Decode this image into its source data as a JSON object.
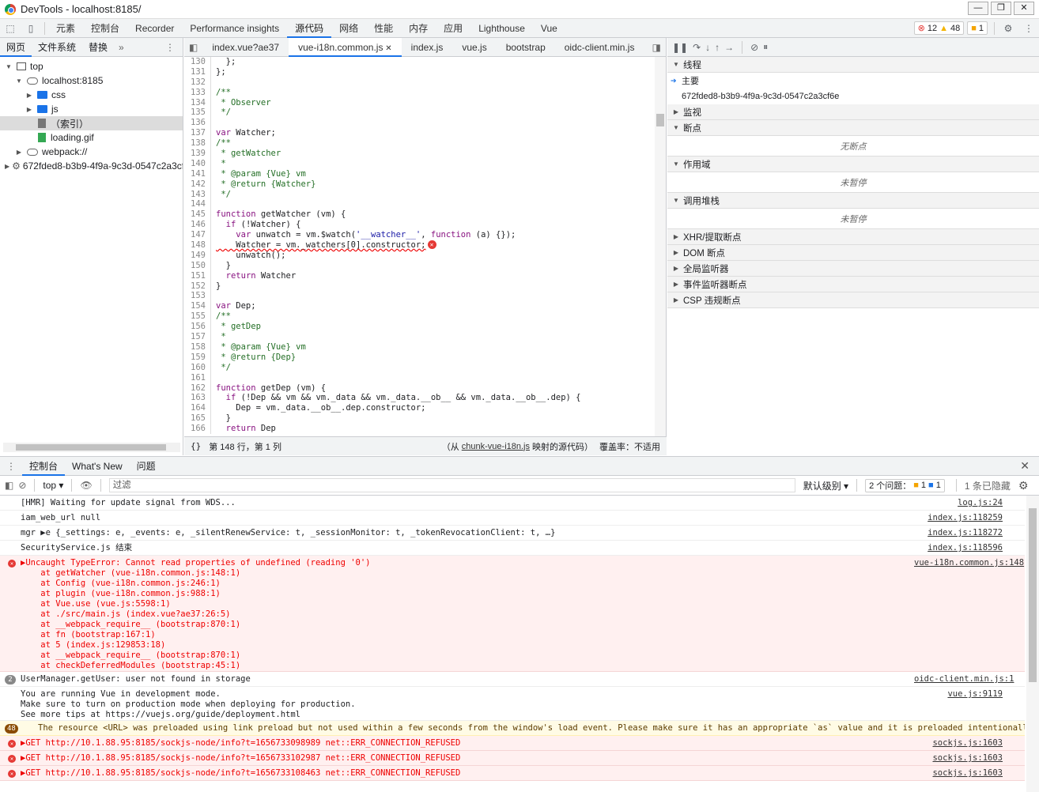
{
  "window": {
    "title": "DevTools - localhost:8185/"
  },
  "tabs": [
    "元素",
    "控制台",
    "Recorder",
    "Performance insights",
    "源代码",
    "网络",
    "性能",
    "内存",
    "应用",
    "Lighthouse",
    "Vue"
  ],
  "counts": {
    "errors": "12",
    "warnings": "48",
    "issues": "1"
  },
  "nav": {
    "tabs": [
      "网页",
      "文件系统",
      "替换"
    ],
    "tree": [
      {
        "label": "top",
        "indent": 0,
        "tri": "▼",
        "icon": "frame"
      },
      {
        "label": "localhost:8185",
        "indent": 1,
        "tri": "▼",
        "icon": "cloud"
      },
      {
        "label": "css",
        "indent": 2,
        "tri": "▶",
        "icon": "folder"
      },
      {
        "label": "js",
        "indent": 2,
        "tri": "▶",
        "icon": "folder"
      },
      {
        "label": "（索引）",
        "indent": 2,
        "tri": "",
        "icon": "file",
        "selected": true
      },
      {
        "label": "loading.gif",
        "indent": 2,
        "tri": "",
        "icon": "filegreen"
      },
      {
        "label": "webpack://",
        "indent": 1,
        "tri": "▶",
        "icon": "cloud"
      },
      {
        "label": "672fded8-b3b9-4f9a-9c3d-0547c2a3cf6e",
        "indent": 0,
        "tri": "▶",
        "icon": "gear"
      }
    ]
  },
  "editor": {
    "files": [
      "index.vue?ae37",
      "vue-i18n.common.js",
      "index.js",
      "vue.js",
      "bootstrap",
      "oidc-client.min.js"
    ],
    "lines": [
      {
        "n": "130",
        "t": "  };"
      },
      {
        "n": "131",
        "t": "};"
      },
      {
        "n": "132",
        "t": ""
      },
      {
        "n": "133",
        "t": "/**",
        "c": "cm"
      },
      {
        "n": "134",
        "t": " * Observer",
        "c": "cm"
      },
      {
        "n": "135",
        "t": " */",
        "c": "cm"
      },
      {
        "n": "136",
        "t": ""
      },
      {
        "n": "137",
        "t": "var Watcher;"
      },
      {
        "n": "138",
        "t": "/**",
        "c": "cm"
      },
      {
        "n": "139",
        "t": " * getWatcher",
        "c": "cm"
      },
      {
        "n": "140",
        "t": " *",
        "c": "cm"
      },
      {
        "n": "141",
        "t": " * @param {Vue} vm",
        "c": "cm"
      },
      {
        "n": "142",
        "t": " * @return {Watcher}",
        "c": "cm"
      },
      {
        "n": "143",
        "t": " */",
        "c": "cm"
      },
      {
        "n": "144",
        "t": ""
      },
      {
        "n": "145",
        "t": "function getWatcher (vm) {"
      },
      {
        "n": "146",
        "t": "  if (!Watcher) {"
      },
      {
        "n": "147",
        "t": "    var unwatch = vm.$watch('__watcher__', function (a) {});"
      },
      {
        "n": "148",
        "t": "    Watcher = vm._watchers[0].constructor;",
        "err": true
      },
      {
        "n": "149",
        "t": "    unwatch();"
      },
      {
        "n": "150",
        "t": "  }"
      },
      {
        "n": "151",
        "t": "  return Watcher"
      },
      {
        "n": "152",
        "t": "}"
      },
      {
        "n": "153",
        "t": ""
      },
      {
        "n": "154",
        "t": "var Dep;"
      },
      {
        "n": "155",
        "t": "/**",
        "c": "cm"
      },
      {
        "n": "156",
        "t": " * getDep",
        "c": "cm"
      },
      {
        "n": "157",
        "t": " *",
        "c": "cm"
      },
      {
        "n": "158",
        "t": " * @param {Vue} vm",
        "c": "cm"
      },
      {
        "n": "159",
        "t": " * @return {Dep}",
        "c": "cm"
      },
      {
        "n": "160",
        "t": " */",
        "c": "cm"
      },
      {
        "n": "161",
        "t": ""
      },
      {
        "n": "162",
        "t": "function getDep (vm) {"
      },
      {
        "n": "163",
        "t": "  if (!Dep && vm && vm._data && vm._data.__ob__ && vm._data.__ob__.dep) {"
      },
      {
        "n": "164",
        "t": "    Dep = vm._data.__ob__.dep.constructor;"
      },
      {
        "n": "165",
        "t": "  }"
      },
      {
        "n": "166",
        "t": "  return Dep"
      }
    ],
    "status": {
      "braces": "{}",
      "position": "第 148 行，第 1 列",
      "mapped_prefix": "（从",
      "mapped_file": "chunk-vue-i18n.js",
      "mapped_suffix": "映射的源代码）",
      "coverage": "覆盖率：不适用"
    }
  },
  "debugger": {
    "threads_title": "线程",
    "main_thread": "主要",
    "worker": "672fded8-b3b9-4f9a-9c3d-0547c2a3cf6e",
    "watch": "监视",
    "breakpoints": "断点",
    "no_breakpoints": "无断点",
    "scope": "作用域",
    "not_paused": "未暂停",
    "callstack": "调用堆栈",
    "not_paused2": "未暂停",
    "sections": [
      "XHR/提取断点",
      "DOM 断点",
      "全局监听器",
      "事件监听器断点",
      "CSP 违规断点"
    ]
  },
  "drawer": {
    "tabs": [
      "控制台",
      "What's New",
      "问题"
    ]
  },
  "console": {
    "context": "top",
    "filter_placeholder": "过滤",
    "levels": "默认级别",
    "issues_label": "2 个问题：",
    "issues_a": "1",
    "issues_b": "1",
    "hidden": "1 条已隐藏",
    "messages": [
      {
        "type": "log",
        "text": "[HMR] Waiting for update signal from WDS...",
        "src": "log.js:24"
      },
      {
        "type": "log",
        "text": "iam_web_url null",
        "src": "index.js:118259"
      },
      {
        "type": "log",
        "text": "mgr ▶e {_settings: e, _events: e, _silentRenewService: t, _sessionMonitor: t, _tokenRevocationClient: t, …}",
        "src": "index.js:118272"
      },
      {
        "type": "log",
        "text": "SecurityService.js 结束",
        "src": "index.js:118596"
      },
      {
        "type": "err",
        "text": "▶Uncaught TypeError: Cannot read properties of undefined (reading '0')\n    at getWatcher (vue-i18n.common.js:148:1)\n    at Config (vue-i18n.common.js:246:1)\n    at plugin (vue-i18n.common.js:988:1)\n    at Vue.use (vue.js:5598:1)\n    at ./src/main.js (index.vue?ae37:26:5)\n    at __webpack_require__ (bootstrap:870:1)\n    at fn (bootstrap:167:1)\n    at 5 (index.js:129853:18)\n    at __webpack_require__ (bootstrap:870:1)\n    at checkDeferredModules (bootstrap:45:1)",
        "src": "vue-i18n.common.js:148"
      },
      {
        "type": "log",
        "text": "UserManager.getUser: user not found in storage",
        "src": "oidc-client.min.js:1",
        "count": "2"
      },
      {
        "type": "log",
        "text": "You are running Vue in development mode.\nMake sure to turn on production mode when deploying for production.\nSee more tips at https://vuejs.org/guide/deployment.html",
        "src": "vue.js:9119"
      },
      {
        "type": "warn",
        "text": "The resource <URL> was preloaded using link preload but not used within a few seconds from the window's load event. Please make sure it has an appropriate `as` value and it is preloaded intentionally.",
        "src": "",
        "count": "48"
      },
      {
        "type": "err",
        "text": "▶GET http://10.1.88.95:8185/sockjs-node/info?t=1656733098989 net::ERR_CONNECTION_REFUSED",
        "src": "sockjs.js:1603"
      },
      {
        "type": "err",
        "text": "▶GET http://10.1.88.95:8185/sockjs-node/info?t=1656733102987 net::ERR_CONNECTION_REFUSED",
        "src": "sockjs.js:1603"
      },
      {
        "type": "err",
        "text": "▶GET http://10.1.88.95:8185/sockjs-node/info?t=1656733108463 net::ERR_CONNECTION_REFUSED",
        "src": "sockjs.js:1603"
      }
    ]
  }
}
